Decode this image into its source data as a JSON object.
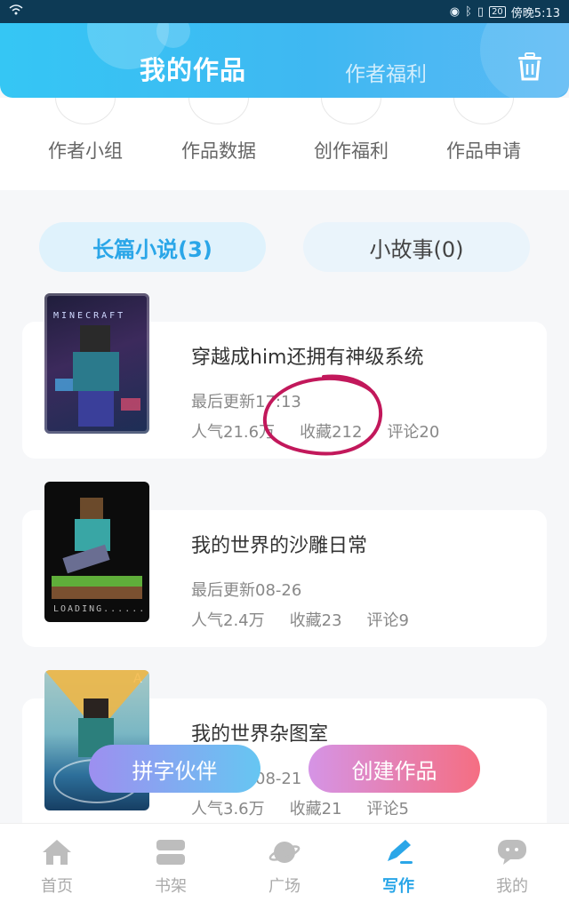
{
  "status_bar": {
    "time": "傍晚5:13",
    "battery": "20"
  },
  "header": {
    "tab_main": "我的作品",
    "tab_side": "作者福利"
  },
  "quick_actions": [
    {
      "label": "作者小组"
    },
    {
      "label": "作品数据"
    },
    {
      "label": "创作福利"
    },
    {
      "label": "作品申请"
    }
  ],
  "segments": {
    "long_novel": "长篇小说(3)",
    "short_story": "小故事(0)"
  },
  "works": [
    {
      "title": "穿越成him还拥有神级系统",
      "updated": "最后更新17:13",
      "popularity": "人气21.6万",
      "favorites": "收藏212",
      "comments": "评论20",
      "cover_text": "MINECRAFT"
    },
    {
      "title": "我的世界的沙雕日常",
      "updated": "最后更新08-26",
      "popularity": "人气2.4万",
      "favorites": "收藏23",
      "comments": "评论9",
      "cover_text": "LOADING......"
    },
    {
      "title": "我的世界杂图室",
      "updated": "最后更新08-21",
      "popularity": "人气3.6万",
      "favorites": "收藏21",
      "comments": "评论5",
      "cover_text": "A"
    }
  ],
  "fabs": {
    "left": "拼字伙伴",
    "right": "创建作品"
  },
  "bottom_nav": [
    {
      "label": "首页"
    },
    {
      "label": "书架"
    },
    {
      "label": "广场"
    },
    {
      "label": "写作"
    },
    {
      "label": "我的"
    }
  ],
  "colors": {
    "accent": "#2aa6e8",
    "header_start": "#35c6f4",
    "annotation": "#c2185b"
  }
}
